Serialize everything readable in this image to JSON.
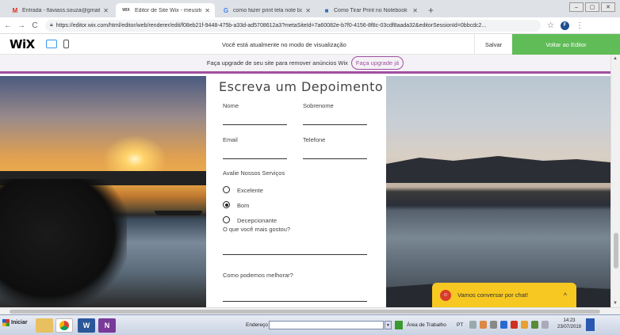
{
  "browser": {
    "tabs": [
      {
        "icon": "gmail-icon",
        "glyph": "M",
        "color": "#d93025",
        "label": "Entrada - flaviass.souza@gmail.c"
      },
      {
        "icon": "wix-icon",
        "glyph": "WIX",
        "color": "#000000",
        "label": "Editor de Site Wix - meusite"
      },
      {
        "icon": "google-icon",
        "glyph": "G",
        "color": "#4285f4",
        "label": "como fazer print tela note book"
      },
      {
        "icon": "bing-icon",
        "glyph": "■",
        "color": "#2b6fb6",
        "label": "Como Tirar Print no Notebook S"
      }
    ],
    "new_tab": "+",
    "window_buttons": [
      "–",
      "▢",
      "✕"
    ],
    "url": "https://editor.wix.com/html/editor/web/renderer/edit/f08eb21f-9448-475b-a33d-ad5708612a3?metaSiteId=7a60082e-b7f0-4156-8f8c-03cdf8aada32&editorSessionId=0bbcdc2..."
  },
  "wix": {
    "logo": "WiX",
    "preview_message": "Você está atualmente no modo de visualização",
    "save_label": "Salvar",
    "back_label": "Voltar ao Editor",
    "upgrade_text": "Faça upgrade de seu site para remover anúncios Wix",
    "upgrade_button": "Faça upgrade já"
  },
  "form": {
    "title": "Escreva um Depoimento",
    "fields": {
      "nome": "Nome",
      "sobrenome": "Sobrenome",
      "email": "Email",
      "telefone": "Telefone"
    },
    "rating_label": "Avalie Nossos Serviços",
    "options": [
      {
        "label": "Excelente",
        "checked": false
      },
      {
        "label": "Bom",
        "checked": true
      },
      {
        "label": "Decepcionante",
        "checked": false
      }
    ],
    "liked_label": "O que você mais gostou?",
    "improve_label": "Como podemos melhorar?"
  },
  "chat": {
    "label": "Vamos conversar por chat!",
    "chevron": "^"
  },
  "taskbar": {
    "start_label": "Iniciar",
    "address_label": "Endereço",
    "desktop_label": "Área de Trabalho",
    "language": "PT",
    "time": "14:23",
    "date": "23/07/2019"
  }
}
